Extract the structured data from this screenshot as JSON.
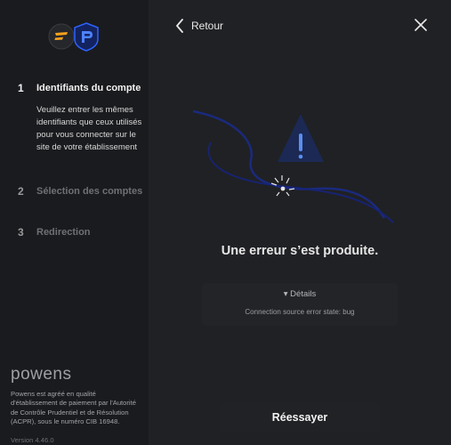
{
  "nav": {
    "back_label": "Retour"
  },
  "steps": [
    {
      "number": "1",
      "title": "Identifiants du compte",
      "description": "Veuillez entrer les mêmes identifiants que ceux utilisés pour vous connecter sur le site de votre établissement",
      "state": "active"
    },
    {
      "number": "2",
      "title": "Sélection des comptes",
      "state": "inactive"
    },
    {
      "number": "3",
      "title": "Redirection",
      "state": "inactive"
    }
  ],
  "footer": {
    "brand": "powens",
    "legal": "Powens est agréé en qualité d'établissement de paiement par l'Autorité de Contrôle Prudentiel et de Résolution (ACPR), sous le numéro CIB 16948.",
    "version": "Version 4.46.0"
  },
  "error": {
    "title": "Une erreur s’est produite.",
    "details_label": "▾ Détails",
    "detail_text": "Connection source error state: bug"
  },
  "actions": {
    "retry_label": "Réessayer"
  },
  "colors": {
    "background": "#1d1e21",
    "sidebar": "#1a1b1e",
    "accent_blue": "#5b8def",
    "illustration_line": "#1a2c8f",
    "logo_orange": "#f7a21b",
    "logo_blue": "#2d63ff"
  },
  "icons": [
    "app-logo-icon",
    "bank-logo-icon",
    "chevron-left-icon",
    "close-icon",
    "warning-icon",
    "broken-connection-icon"
  ]
}
